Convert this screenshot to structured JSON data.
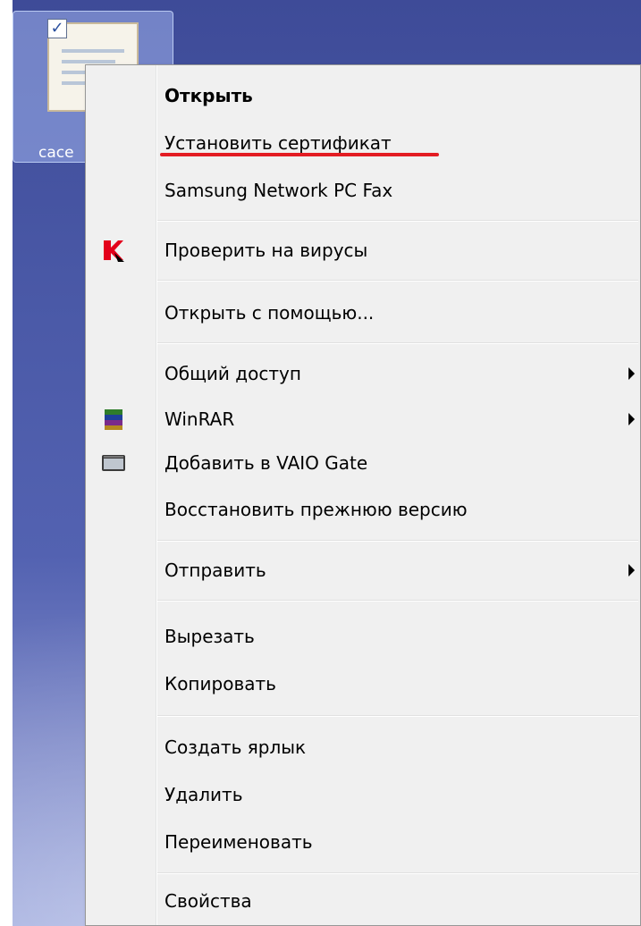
{
  "desktop": {
    "icon_label": "cace"
  },
  "context_menu": {
    "items": [
      {
        "label": "Открыть",
        "bold": true
      },
      {
        "label": "Установить сертификат"
      },
      {
        "label": "Samsung Network PC Fax"
      },
      {
        "label": "Проверить на вирусы",
        "icon": "kaspersky-icon"
      },
      {
        "label": "Открыть с помощью..."
      },
      {
        "label": "Общий доступ",
        "submenu": true
      },
      {
        "label": "WinRAR",
        "submenu": true,
        "icon": "winrar-icon"
      },
      {
        "label": "Добавить в VAIO Gate",
        "icon": "vaio-gate-icon"
      },
      {
        "label": "Восстановить прежнюю версию"
      },
      {
        "label": "Отправить",
        "submenu": true
      },
      {
        "label": "Вырезать"
      },
      {
        "label": "Копировать"
      },
      {
        "label": "Создать ярлык"
      },
      {
        "label": "Удалить"
      },
      {
        "label": "Переименовать"
      },
      {
        "label": "Свойства"
      }
    ],
    "highlight_color": "#e31c23"
  }
}
